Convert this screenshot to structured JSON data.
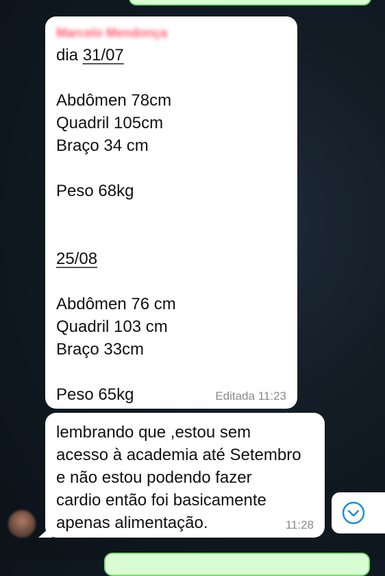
{
  "messages": [
    {
      "sender": "Marcelo Mendonça",
      "lines": {
        "date1": "dia 31/07",
        "abdomen1": "Abdômen 78cm",
        "quadril1": "Quadril 105cm",
        "braco1": "Braço 34 cm",
        "peso1": "Peso 68kg",
        "date2": "25/08",
        "abdomen2": "Abdômen 76 cm",
        "quadril2": "Quadril 103 cm",
        "braco2": "Braço 33cm",
        "peso2": "Peso 65kg"
      },
      "edited_label": "Editada",
      "time": "11:23"
    },
    {
      "lines": [
        "lembrando que ,estou sem",
        "acesso à academia até Setembro",
        "e não estou podendo fazer",
        "cardio então foi basicamente",
        "apenas alimentação."
      ],
      "time": "11:28"
    }
  ],
  "icons": {
    "scroll_down": "chevron-down-circle-icon",
    "avatar": "avatar"
  },
  "colors": {
    "incoming_bubble": "#ffffff",
    "outgoing_bubble": "#d9fdd3",
    "accent": "#1a8fd8",
    "meta_text": "#8a8a8a"
  }
}
